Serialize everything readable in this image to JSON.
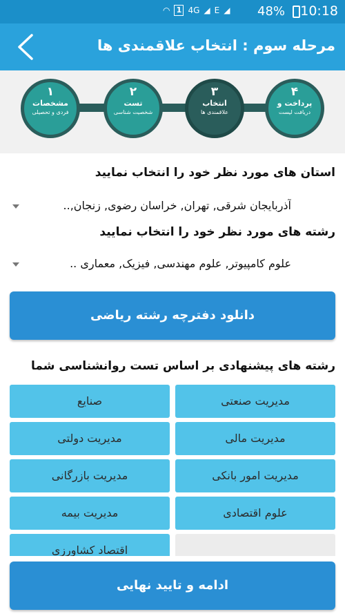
{
  "status": {
    "signal_box": "1",
    "net1": "4G",
    "net2": "E",
    "battery": "48%",
    "time": "10:18"
  },
  "header": {
    "title": "مرحله سوم : انتخاب علاقمندی ها"
  },
  "steps": [
    {
      "num": "۱",
      "title": "مشخصات",
      "sub": "فردی و تحصیلی"
    },
    {
      "num": "۲",
      "title": "تست",
      "sub": "شخصیت شناسی"
    },
    {
      "num": "۳",
      "title": "انتخاب",
      "sub": "علاقمندی ها"
    },
    {
      "num": "۴",
      "title": "پرداخت و",
      "sub": "دریافت لیست"
    }
  ],
  "provinces": {
    "label": "استان های مورد نظر خود را انتخاب نمایید",
    "value": "آذربایجان شرقی, تهران, خراسان رضوی, زنجان,.."
  },
  "majors": {
    "label": "رشته های مورد نظر خود را انتخاب نمایید",
    "value": "علوم کامپیوتر, علوم مهندسی, فیزیک, معماری .."
  },
  "download_button": "دانلود دفترچه رشته ریاضی",
  "suggested": {
    "label": "رشته های پیشنهادی بر اساس تست روانشناسی شما",
    "items": [
      "مدیریت صنعتی",
      "صنایع",
      "مدیریت مالی",
      "مدیریت دولتی",
      "مدیریت امور بانکی",
      "مدیریت بازرگانی",
      "علوم اقتصادی",
      "مدیریت بیمه",
      "",
      "اقتصاد کشاورزی"
    ]
  },
  "confirm_button": "ادامه و تایید نهایی",
  "colors": {
    "statusbar": "#1b8fc9",
    "appbar": "#2aa2dc",
    "step": "#2a9e98",
    "step_active": "#2a5d5b",
    "chip": "#52c3e9",
    "button": "#2a8fd4"
  }
}
